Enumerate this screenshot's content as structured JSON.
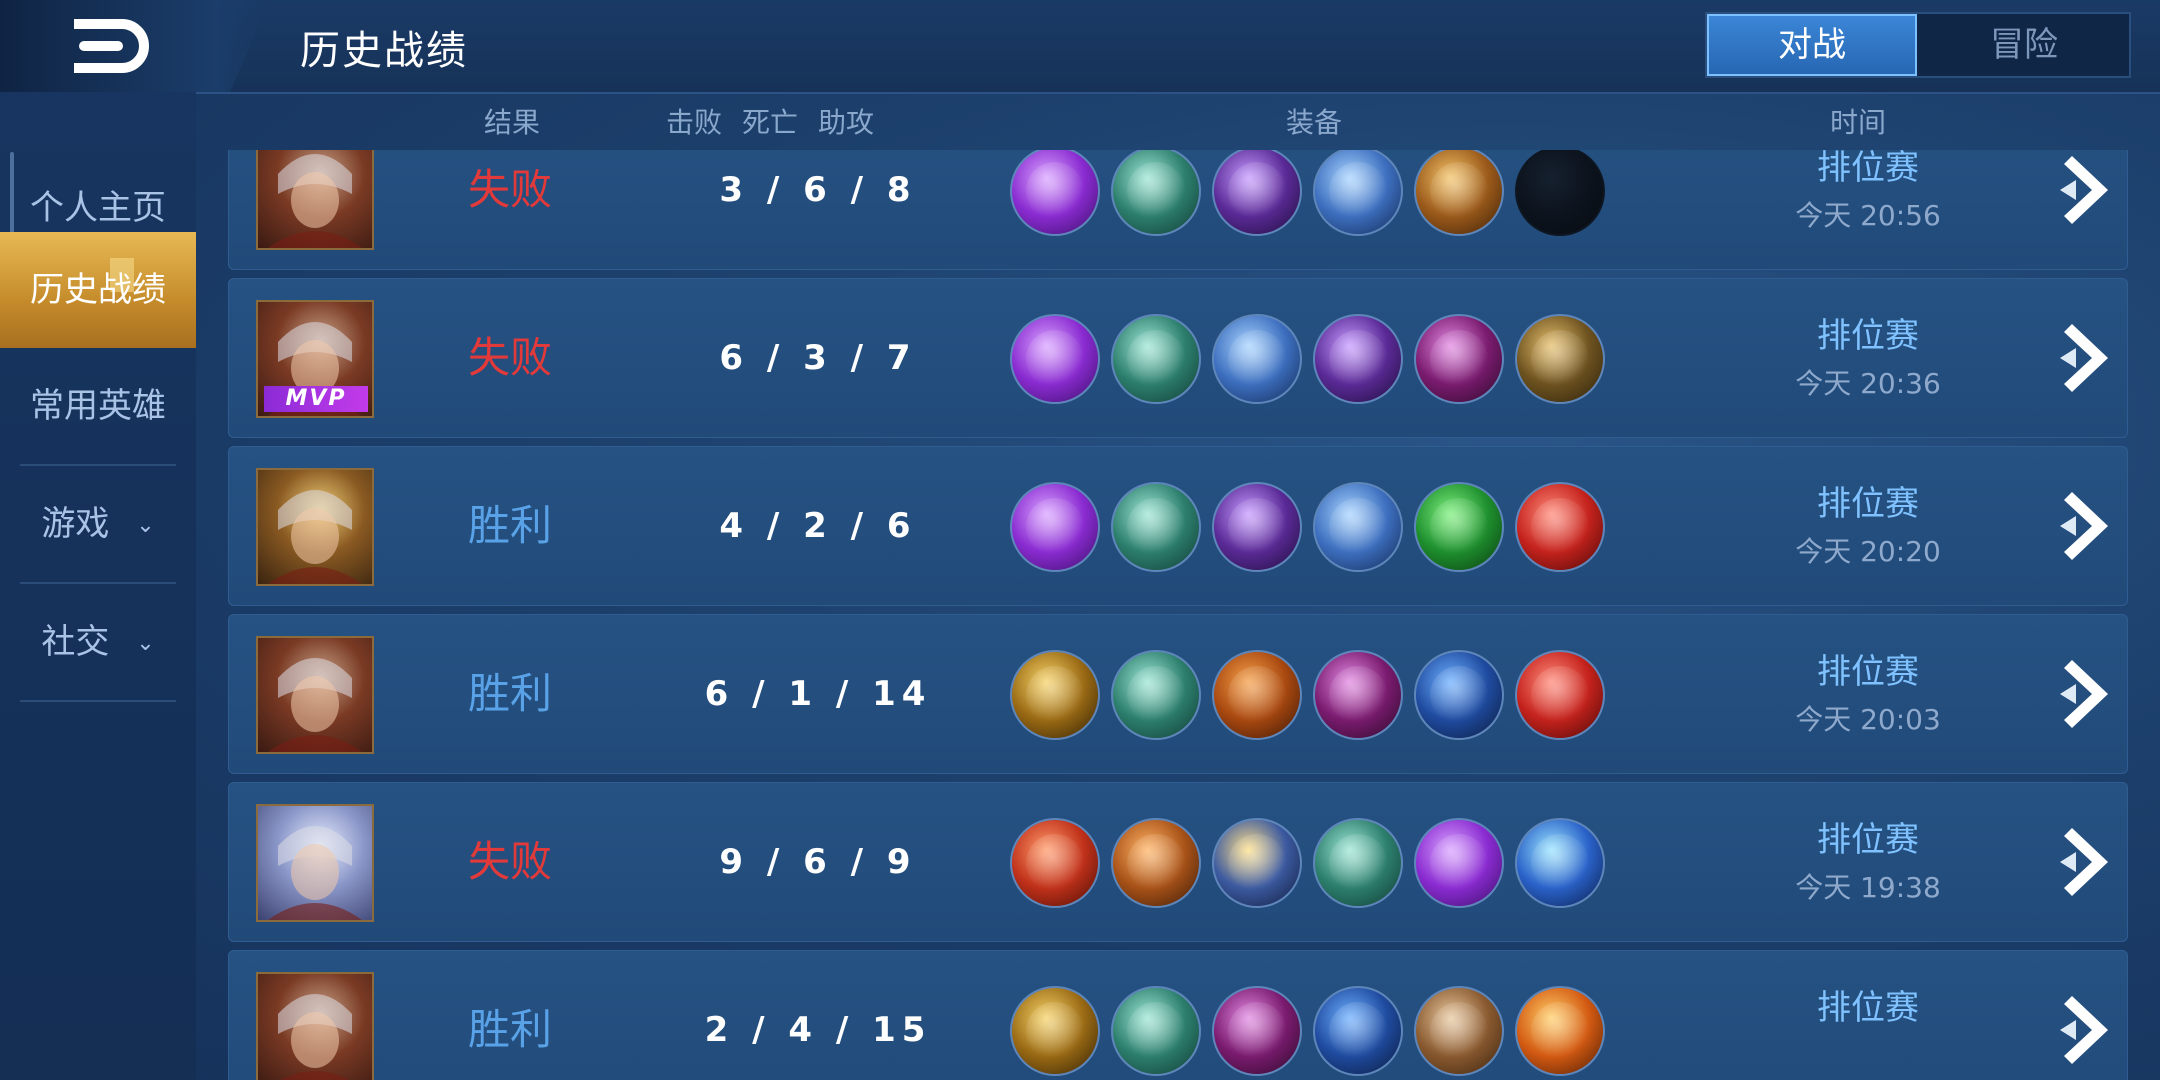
{
  "header": {
    "title": "历史战绩",
    "tabs": [
      {
        "label": "对战",
        "active": true
      },
      {
        "label": "冒险",
        "active": false
      }
    ]
  },
  "sidebar": {
    "items": [
      {
        "label": "个人主页",
        "active": false
      },
      {
        "label": "历史战绩",
        "active": true
      },
      {
        "label": "常用英雄",
        "active": false
      },
      {
        "label": "游戏",
        "active": false,
        "expandable": true
      },
      {
        "label": "社交",
        "active": false,
        "expandable": true
      }
    ]
  },
  "columns": {
    "result": "结果",
    "kill": "击败",
    "death": "死亡",
    "assist": "助攻",
    "equipment": "装备",
    "time": "时间"
  },
  "colors": {
    "lose": "#e23a3a",
    "win": "#5aa2e8",
    "active_sidebar": "#e7b955"
  },
  "matches": [
    {
      "result": "失败",
      "outcome": "lose",
      "kda": "3 / 6 / 8",
      "mvp": false,
      "mode": "排位赛",
      "time": "今天 20:56",
      "hero": "hero-red-scarf",
      "items": [
        "purple-axe",
        "green-boots",
        "purple-blade",
        "blue-blade",
        "gold-armor",
        "empty"
      ]
    },
    {
      "result": "失败",
      "outcome": "lose",
      "kda": "6 / 3 / 7",
      "mvp": true,
      "mvp_label": "MVP",
      "mode": "排位赛",
      "time": "今天 20:36",
      "hero": "hero-red-scarf",
      "items": [
        "purple-axe",
        "green-boots",
        "blue-blade",
        "purple-blade",
        "purple-armor",
        "gold-cloak"
      ]
    },
    {
      "result": "胜利",
      "outcome": "win",
      "kda": "4 / 2 / 6",
      "mvp": false,
      "mode": "排位赛",
      "time": "今天 20:20",
      "hero": "hero-gold",
      "items": [
        "purple-axe",
        "green-boots",
        "purple-blade",
        "blue-blade",
        "green-gem",
        "red-gem"
      ]
    },
    {
      "result": "胜利",
      "outcome": "win",
      "kda": "6 / 1 / 14",
      "mvp": false,
      "mode": "排位赛",
      "time": "今天 20:03",
      "hero": "hero-red-scarf",
      "items": [
        "gold-shield",
        "green-boots",
        "orange-armor",
        "purple-armor",
        "blue-cloak",
        "red-gem"
      ]
    },
    {
      "result": "失败",
      "outcome": "lose",
      "kda": "9 / 6 / 9",
      "mvp": false,
      "mode": "排位赛",
      "time": "今天 19:38",
      "hero": "hero-silver",
      "items": [
        "red-blade",
        "orange-blade",
        "gold-star",
        "green-boots",
        "purple-axe",
        "blue-spear"
      ]
    },
    {
      "result": "胜利",
      "outcome": "win",
      "kda": "2 / 4 / 15",
      "mvp": false,
      "mode": "排位赛",
      "time": "",
      "hero": "hero-red-scarf",
      "items": [
        "gold-shield",
        "green-boots",
        "purple-armor",
        "blue-cloak",
        "brown-bag",
        "orange-orb"
      ]
    }
  ]
}
